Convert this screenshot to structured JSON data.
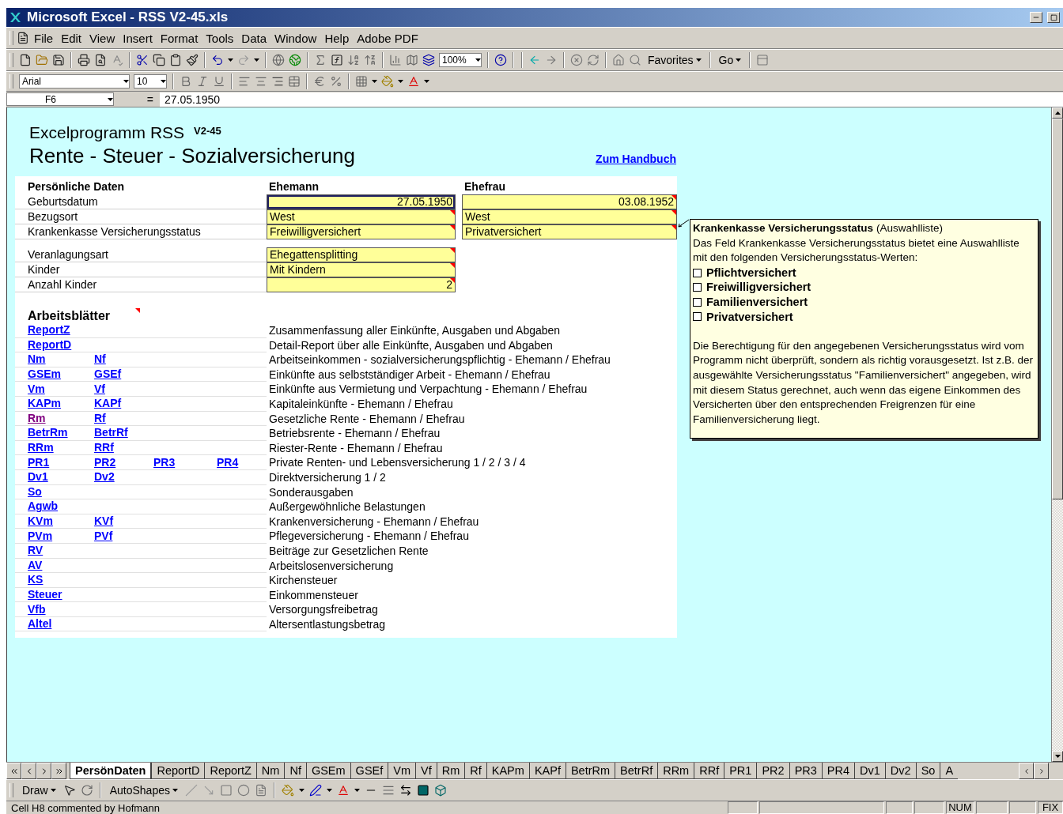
{
  "window": {
    "title": "Microsoft Excel - RSS V2-45.xls"
  },
  "menu": [
    "File",
    "Edit",
    "View",
    "Insert",
    "Format",
    "Tools",
    "Data",
    "Window",
    "Help",
    "Adobe PDF"
  ],
  "standard_toolbar": {
    "zoom": "100%",
    "favorites": "Favorites",
    "go": "Go"
  },
  "formatting_toolbar": {
    "font": "Arial",
    "size": "10"
  },
  "formula_bar": {
    "name_box": "F6",
    "equals": "=",
    "value": "27.05.1950"
  },
  "sheet": {
    "title": "Excelprogramm RSS",
    "version": "V2-45",
    "subtitle": "Rente - Steuer - Sozialversicherung",
    "manual_link": "Zum Handbuch",
    "personal": {
      "heading": "Persönliche Daten",
      "columns": [
        "Ehemann",
        "Ehefrau"
      ],
      "groups": [
        {
          "rows": [
            {
              "label": "Geburtsdatum",
              "cells": [
                {
                  "value": "27.05.1950",
                  "kind": "date",
                  "selected": true,
                  "commented": false
                },
                {
                  "value": "03.08.1952",
                  "kind": "date",
                  "selected": false,
                  "commented": true
                }
              ]
            },
            {
              "label": "Bezugsort",
              "cells": [
                {
                  "value": "West",
                  "kind": "text",
                  "selected": false,
                  "commented": true
                },
                {
                  "value": "West",
                  "kind": "text",
                  "selected": false,
                  "commented": true
                }
              ]
            },
            {
              "label": "Krankenkasse Versicherungsstatus",
              "cells": [
                {
                  "value": "Freiwilligversichert",
                  "kind": "text",
                  "selected": false,
                  "commented": true
                },
                {
                  "value": "Privatversichert",
                  "kind": "text",
                  "selected": false,
                  "commented": true
                }
              ]
            }
          ]
        },
        {
          "rows": [
            {
              "label": "Veranlagungsart",
              "cells": [
                {
                  "value": "Ehegattensplitting",
                  "kind": "text",
                  "selected": false,
                  "commented": true
                }
              ]
            },
            {
              "label": "Kinder",
              "cells": [
                {
                  "value": "Mit Kindern",
                  "kind": "text",
                  "selected": false,
                  "commented": true
                }
              ]
            },
            {
              "label": "Anzahl Kinder",
              "cells": [
                {
                  "value": "2",
                  "kind": "number",
                  "selected": false,
                  "commented": true
                }
              ]
            }
          ]
        }
      ]
    },
    "worksheets": {
      "heading": "Arbeitsblätter",
      "commented": true,
      "rows": [
        {
          "links": [
            {
              "text": "ReportZ",
              "visited": false
            }
          ],
          "description": "Zusammenfassung aller Einkünfte, Ausgaben und Abgaben"
        },
        {
          "links": [
            {
              "text": "ReportD",
              "visited": false
            }
          ],
          "description": "Detail-Report über alle Einkünfte, Ausgaben und Abgaben"
        },
        {
          "links": [
            {
              "text": "Nm",
              "visited": false
            },
            {
              "text": "Nf",
              "visited": false
            }
          ],
          "description": "Arbeitseinkommen - sozialversicherungspflichtig - Ehemann / Ehefrau"
        },
        {
          "links": [
            {
              "text": "GSEm",
              "visited": false
            },
            {
              "text": "GSEf",
              "visited": false
            }
          ],
          "description": "Einkünfte aus selbstständiger Arbeit - Ehemann / Ehefrau"
        },
        {
          "links": [
            {
              "text": "Vm",
              "visited": false
            },
            {
              "text": "Vf",
              "visited": false
            }
          ],
          "description": "Einkünfte aus Vermietung und Verpachtung - Ehemann / Ehefrau"
        },
        {
          "links": [
            {
              "text": "KAPm",
              "visited": false
            },
            {
              "text": "KAPf",
              "visited": false
            }
          ],
          "description": "Kapitaleinkünfte - Ehemann / Ehefrau"
        },
        {
          "links": [
            {
              "text": "Rm",
              "visited": true
            },
            {
              "text": "Rf",
              "visited": false
            }
          ],
          "description": "Gesetzliche Rente - Ehemann / Ehefrau"
        },
        {
          "links": [
            {
              "text": "BetrRm",
              "visited": false
            },
            {
              "text": "BetrRf",
              "visited": false
            }
          ],
          "description": "Betriebsrente  - Ehemann / Ehefrau"
        },
        {
          "links": [
            {
              "text": "RRm",
              "visited": false
            },
            {
              "text": "RRf",
              "visited": false
            }
          ],
          "description": "Riester-Rente - Ehemann / Ehefrau"
        },
        {
          "links": [
            {
              "text": "PR1",
              "visited": false
            },
            {
              "text": "PR2",
              "visited": false
            },
            {
              "text": "PR3",
              "visited": false
            },
            {
              "text": "PR4",
              "visited": false
            }
          ],
          "description": "Private Renten- und Lebensversicherung 1 / 2 / 3 / 4"
        },
        {
          "links": [
            {
              "text": "Dv1",
              "visited": false
            },
            {
              "text": "Dv2",
              "visited": false
            }
          ],
          "description": "Direktversicherung 1 / 2"
        },
        {
          "links": [
            {
              "text": "So",
              "visited": false
            }
          ],
          "description": "Sonderausgaben"
        },
        {
          "links": [
            {
              "text": "Agwb",
              "visited": false
            }
          ],
          "description": "Außergewöhnliche Belastungen"
        },
        {
          "links": [
            {
              "text": "KVm",
              "visited": false
            },
            {
              "text": "KVf",
              "visited": false
            }
          ],
          "description": "Krankenversicherung - Ehemann / Ehefrau"
        },
        {
          "links": [
            {
              "text": "PVm",
              "visited": false
            },
            {
              "text": "PVf",
              "visited": false
            }
          ],
          "description": "Pflegeversicherung - Ehemann / Ehefrau"
        },
        {
          "links": [
            {
              "text": "RV",
              "visited": false
            }
          ],
          "description": "Beiträge zur Gesetzlichen Rente"
        },
        {
          "links": [
            {
              "text": "AV",
              "visited": false
            }
          ],
          "description": "Arbeitslosenversicherung"
        },
        {
          "links": [
            {
              "text": "KS",
              "visited": false
            }
          ],
          "description": "Kirchensteuer"
        },
        {
          "links": [
            {
              "text": "Steuer",
              "visited": false
            }
          ],
          "description": "Einkommensteuer"
        },
        {
          "links": [
            {
              "text": "Vfb",
              "visited": false
            }
          ],
          "description": "Versorgungsfreibetrag"
        },
        {
          "links": [
            {
              "text": "Altel",
              "visited": false
            }
          ],
          "description": "Altersentlastungsbetrag"
        }
      ]
    },
    "comment": {
      "title": "Krankenkasse Versicherungsstatus",
      "title_note": "(Auswahlliste)",
      "intro": "Das Feld Krankenkasse Versicherungsstatus bietet eine Auswahlliste mit den folgenden Versicherungsstatus-Werten:",
      "options": [
        {
          "label": "Pflichtversichert",
          "checked": false
        },
        {
          "label": "Freiwilligversichert",
          "checked": false
        },
        {
          "label": "Familienversichert",
          "checked": false
        },
        {
          "label": "Privatversichert",
          "checked": false
        }
      ],
      "note": "Die Berechtigung für den angegebenen Versicherungsstatus wird vom Programm nicht überprüft, sondern als richtig vorausgesetzt. Ist z.B. der ausgewählte Versicherungsstatus \"Familienversichert\" angegeben, wird mit diesem Status gerechnet, auch wenn das eigene Einkommen des Versicherten über den entsprechenden Freigrenzen für eine Familienversicherung liegt."
    }
  },
  "sheet_tabs": [
    {
      "label": "PersönDaten",
      "selected": true
    },
    {
      "label": "ReportD",
      "selected": false
    },
    {
      "label": "ReportZ",
      "selected": false
    },
    {
      "label": "Nm",
      "selected": false
    },
    {
      "label": "Nf",
      "selected": false
    },
    {
      "label": "GSEm",
      "selected": false
    },
    {
      "label": "GSEf",
      "selected": false
    },
    {
      "label": "Vm",
      "selected": false
    },
    {
      "label": "Vf",
      "selected": false
    },
    {
      "label": "Rm",
      "selected": false
    },
    {
      "label": "Rf",
      "selected": false
    },
    {
      "label": "KAPm",
      "selected": false
    },
    {
      "label": "KAPf",
      "selected": false
    },
    {
      "label": "BetrRm",
      "selected": false
    },
    {
      "label": "BetrRf",
      "selected": false
    },
    {
      "label": "RRm",
      "selected": false
    },
    {
      "label": "RRf",
      "selected": false
    },
    {
      "label": "PR1",
      "selected": false
    },
    {
      "label": "PR2",
      "selected": false
    },
    {
      "label": "PR3",
      "selected": false
    },
    {
      "label": "PR4",
      "selected": false
    },
    {
      "label": "Dv1",
      "selected": false
    },
    {
      "label": "Dv2",
      "selected": false
    },
    {
      "label": "So",
      "selected": false
    },
    {
      "label": "A",
      "selected": false
    }
  ],
  "drawing_toolbar": {
    "draw": "Draw",
    "autoshapes": "AutoShapes"
  },
  "status_bar": {
    "message": "Cell H8 commented by Hofmann",
    "num_indicator": "NUM",
    "fix_indicator": "FIX"
  }
}
